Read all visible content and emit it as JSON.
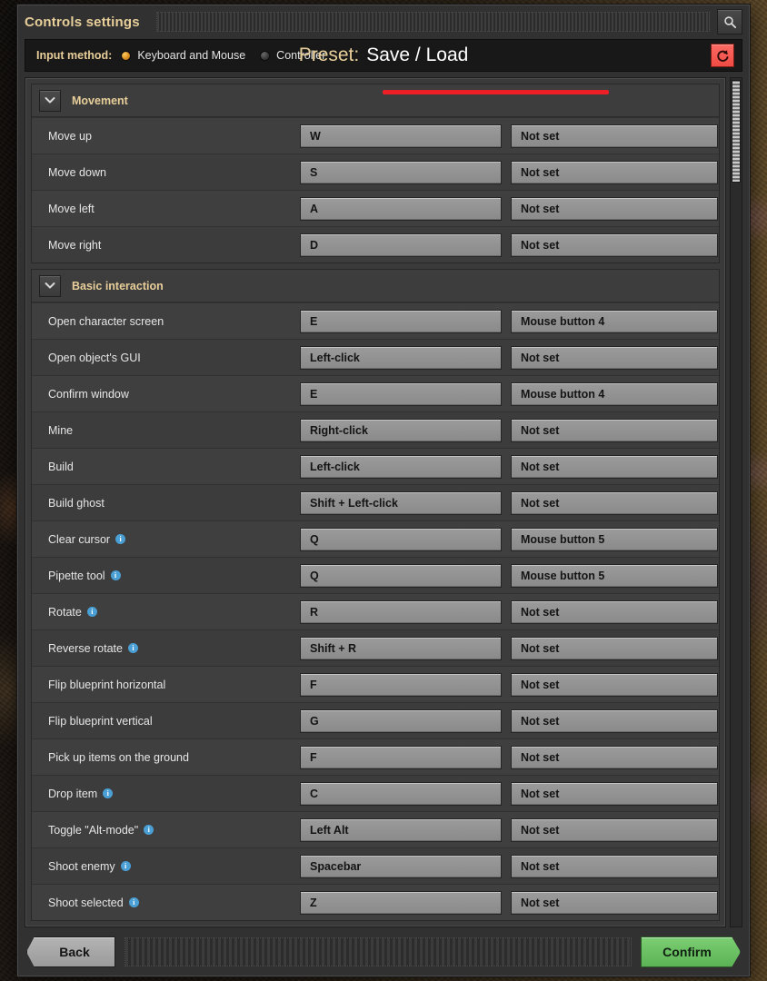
{
  "window": {
    "title": "Controls settings",
    "search_icon": "search-icon"
  },
  "toolbar": {
    "input_method_label": "Input method:",
    "options": [
      {
        "label": "Keyboard and Mouse",
        "selected": true
      },
      {
        "label": "Controller",
        "selected": false
      }
    ],
    "preset_key": "Preset:",
    "preset_value": "Save / Load",
    "reset_icon": "reset-arrow-icon",
    "accent_red": "#ec1f27",
    "accent_amber": "#e8cf9a"
  },
  "sections": [
    {
      "title": "Movement",
      "collapse_icon": "chevron-down-icon",
      "rows": [
        {
          "label": "Move up",
          "info": false,
          "primary": "W",
          "secondary": "Not set"
        },
        {
          "label": "Move down",
          "info": false,
          "primary": "S",
          "secondary": "Not set"
        },
        {
          "label": "Move left",
          "info": false,
          "primary": "A",
          "secondary": "Not set"
        },
        {
          "label": "Move right",
          "info": false,
          "primary": "D",
          "secondary": "Not set"
        }
      ]
    },
    {
      "title": "Basic interaction",
      "collapse_icon": "chevron-down-icon",
      "rows": [
        {
          "label": "Open character screen",
          "info": false,
          "primary": "E",
          "secondary": "Mouse button 4"
        },
        {
          "label": "Open object's GUI",
          "info": false,
          "primary": "Left-click",
          "secondary": "Not set"
        },
        {
          "label": "Confirm window",
          "info": false,
          "primary": "E",
          "secondary": "Mouse button 4"
        },
        {
          "label": "Mine",
          "info": false,
          "primary": "Right-click",
          "secondary": "Not set"
        },
        {
          "label": "Build",
          "info": false,
          "primary": "Left-click",
          "secondary": "Not set"
        },
        {
          "label": "Build ghost",
          "info": false,
          "primary": "Shift + Left-click",
          "secondary": "Not set"
        },
        {
          "label": "Clear cursor",
          "info": true,
          "primary": "Q",
          "secondary": "Mouse button 5"
        },
        {
          "label": "Pipette tool",
          "info": true,
          "primary": "Q",
          "secondary": "Mouse button 5"
        },
        {
          "label": "Rotate",
          "info": true,
          "primary": "R",
          "secondary": "Not set"
        },
        {
          "label": "Reverse rotate",
          "info": true,
          "primary": "Shift + R",
          "secondary": "Not set"
        },
        {
          "label": "Flip blueprint horizontal",
          "info": false,
          "primary": "F",
          "secondary": "Not set"
        },
        {
          "label": "Flip blueprint vertical",
          "info": false,
          "primary": "G",
          "secondary": "Not set"
        },
        {
          "label": "Pick up items on the ground",
          "info": false,
          "primary": "F",
          "secondary": "Not set"
        },
        {
          "label": "Drop item",
          "info": true,
          "primary": "C",
          "secondary": "Not set"
        },
        {
          "label": "Toggle \"Alt-mode\"",
          "info": true,
          "primary": "Left Alt",
          "secondary": "Not set"
        },
        {
          "label": "Shoot enemy",
          "info": true,
          "primary": "Spacebar",
          "secondary": "Not set"
        },
        {
          "label": "Shoot selected",
          "info": true,
          "primary": "Z",
          "secondary": "Not set"
        }
      ]
    }
  ],
  "footer": {
    "back_label": "Back",
    "confirm_label": "Confirm"
  }
}
